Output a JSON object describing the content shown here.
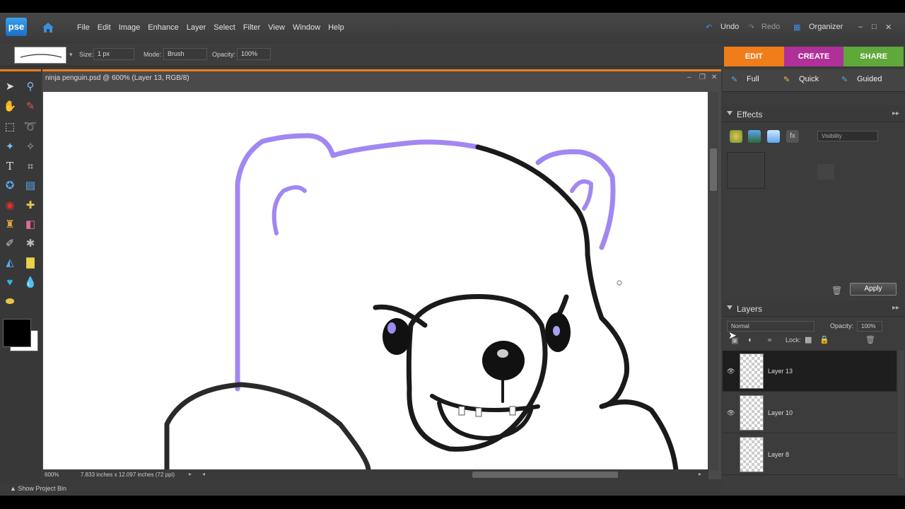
{
  "app": {
    "logo": "pse"
  },
  "menu": [
    "File",
    "Edit",
    "Image",
    "Enhance",
    "Layer",
    "Select",
    "Filter",
    "View",
    "Window",
    "Help"
  ],
  "history": {
    "undo": "Undo",
    "redo": "Redo",
    "organizer": "Organizer"
  },
  "window_controls": {
    "minimize": "–",
    "maximize": "□",
    "close": "✕"
  },
  "options": {
    "size_label": "Size:",
    "size_value": "1 px",
    "mode_label": "Mode:",
    "mode_value": "Brush",
    "opacity_label": "Opacity:",
    "opacity_value": "100%"
  },
  "edit_tabs": [
    {
      "label": "EDIT",
      "color": "#f07d1a"
    },
    {
      "label": "CREATE",
      "color": "#b0309a"
    },
    {
      "label": "SHARE",
      "color": "#5fa83a"
    }
  ],
  "document": {
    "title": "ninja penguin.psd @ 600% (Layer 13, RGB/8)",
    "zoom": "600%",
    "dimensions": "7.833 inches x 12.097 inches (72 ppi)"
  },
  "modes": {
    "full": "Full",
    "quick": "Quick",
    "guided": "Guided"
  },
  "effects": {
    "title": "Effects",
    "filter_value": "Visibility",
    "apply": "Apply"
  },
  "layers": {
    "title": "Layers",
    "blend": "Normal",
    "opacity_label": "Opacity:",
    "opacity_value": "100%",
    "lock_label": "Lock:",
    "items": [
      {
        "name": "Layer 13",
        "selected": true,
        "visible": true
      },
      {
        "name": "Layer 10",
        "selected": false,
        "visible": true
      },
      {
        "name": "Layer 8",
        "selected": false,
        "visible": false
      }
    ]
  },
  "project_bin": "Show Project Bin",
  "colors": {
    "accent": "#f07d1a",
    "sketch": "#9c7cf0",
    "ink": "#111111"
  }
}
